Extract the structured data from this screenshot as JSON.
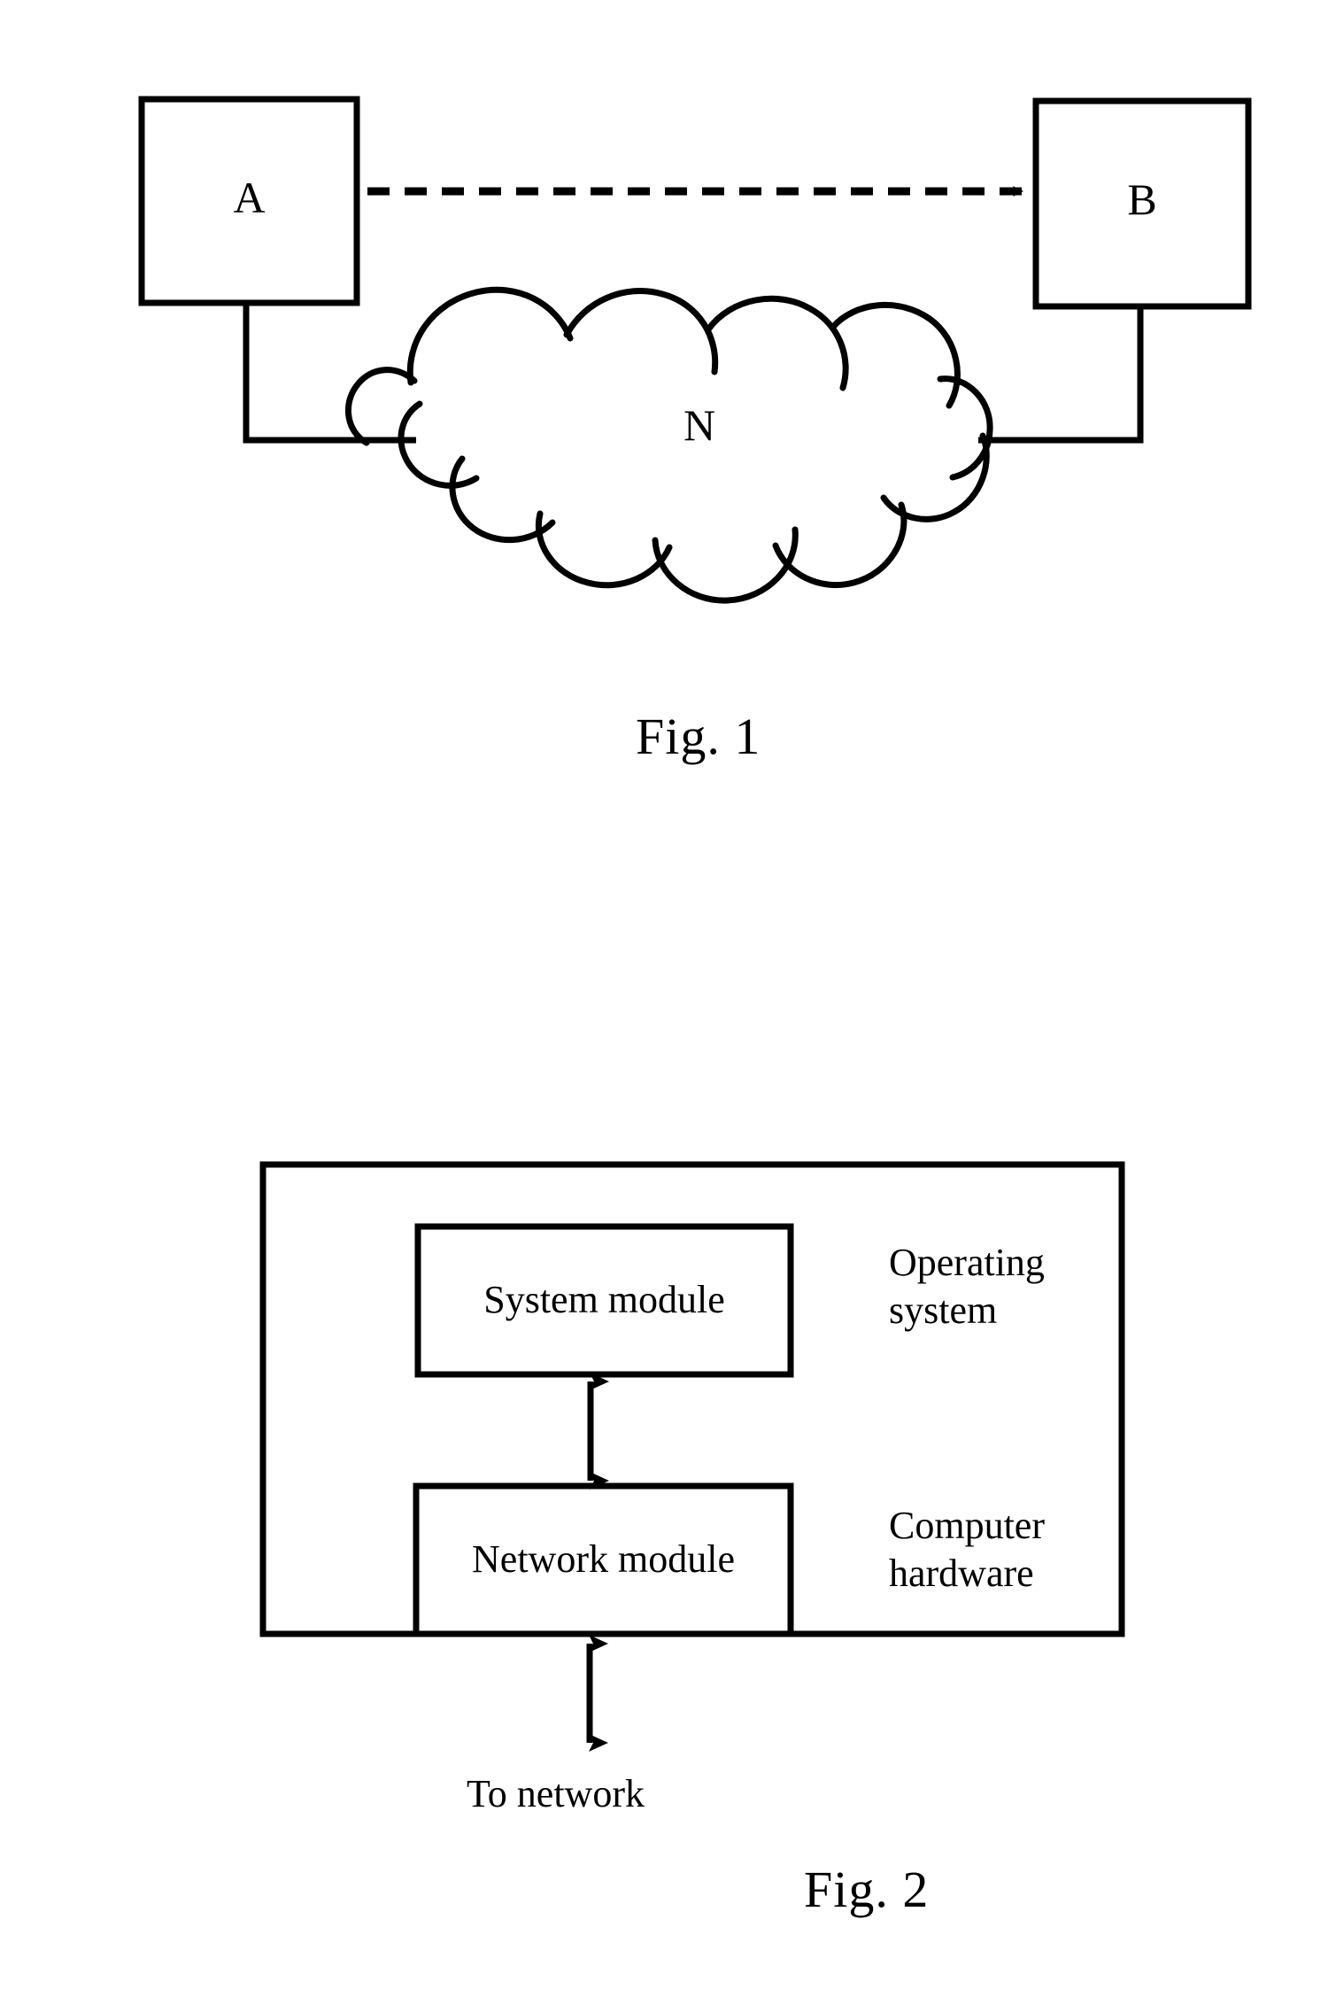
{
  "document": {
    "type": "patent-drawing-sheet",
    "background_color": "#ffffff",
    "ink_color": "#000000"
  },
  "figure1": {
    "caption": "Fig. 1",
    "nodes": [
      {
        "id": "A",
        "label": "A",
        "shape": "rectangle"
      },
      {
        "id": "B",
        "label": "B",
        "shape": "rectangle"
      },
      {
        "id": "N",
        "label": "N",
        "shape": "cloud"
      }
    ],
    "connections": [
      {
        "from": "A",
        "to": "B",
        "style": "dashed",
        "arrow": "single"
      },
      {
        "from": "A",
        "to": "N",
        "style": "solid",
        "arrow": "none"
      },
      {
        "from": "N",
        "to": "B",
        "style": "solid",
        "arrow": "none"
      }
    ]
  },
  "figure2": {
    "caption": "Fig. 2",
    "outer_box": {
      "label": ""
    },
    "inner_boxes": [
      {
        "id": "system-module",
        "label": "System module"
      },
      {
        "id": "network-module",
        "label": "Network module"
      }
    ],
    "side_labels": [
      {
        "id": "operating-system",
        "line1": "Operating",
        "line2": "system"
      },
      {
        "id": "computer-hardware",
        "line1": "Computer",
        "line2": "hardware"
      }
    ],
    "bottom_label": "To network",
    "connections": [
      {
        "from": "system-module",
        "to": "network-module",
        "style": "solid",
        "arrow": "double"
      },
      {
        "from": "network-module",
        "to": "network",
        "style": "solid",
        "arrow": "double"
      }
    ]
  }
}
